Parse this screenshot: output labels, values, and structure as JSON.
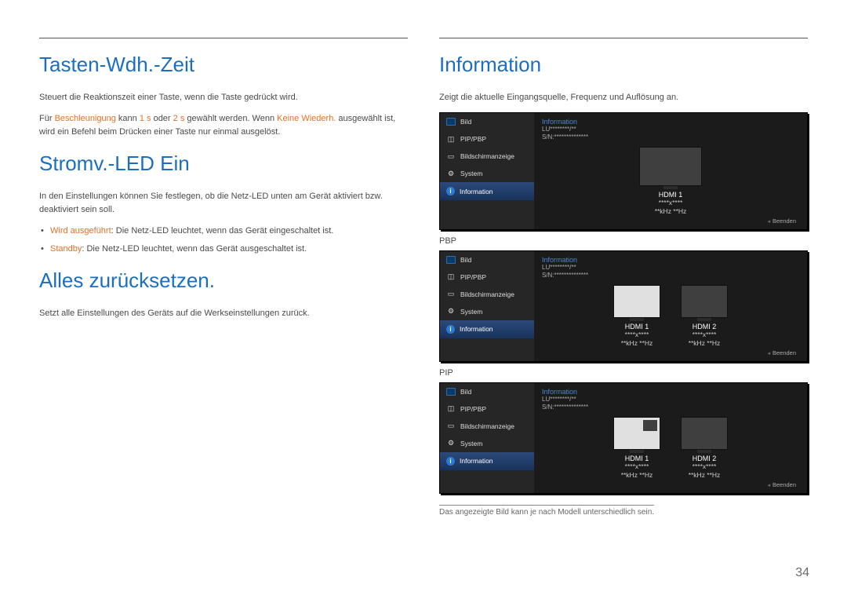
{
  "left": {
    "section1": {
      "title": "Tasten-Wdh.-Zeit",
      "p1": "Steuert die Reaktionszeit einer Taste, wenn die Taste gedrückt wird.",
      "p2_a": "Für ",
      "p2_hl1": "Beschleunigung",
      "p2_b": " kann ",
      "p2_hl2": "1 s",
      "p2_c": " oder ",
      "p2_hl3": "2 s",
      "p2_d": " gewählt werden. Wenn ",
      "p2_hl4": "Keine Wiederh.",
      "p2_e": " ausgewählt ist, wird ein Befehl beim Drücken einer Taste nur einmal ausgelöst."
    },
    "section2": {
      "title": "Stromv.-LED Ein",
      "p1": "In den Einstellungen können Sie festlegen, ob die Netz-LED unten am Gerät aktiviert bzw. deaktiviert sein soll.",
      "b1_hl": "Wird ausgeführt",
      "b1_rest": ": Die Netz-LED leuchtet, wenn das Gerät eingeschaltet ist.",
      "b2_hl": "Standby",
      "b2_rest": ": Die Netz-LED leuchtet, wenn das Gerät ausgeschaltet ist."
    },
    "section3": {
      "title": "Alles zurücksetzen.",
      "p1": "Setzt alle Einstellungen des Geräts auf die Werkseinstellungen zurück."
    }
  },
  "right": {
    "title": "Information",
    "p1": "Zeigt die aktuelle Eingangsquelle, Frequenz und Auflösung an.",
    "pbp_label": "PBP",
    "pip_label": "PIP",
    "footnote": "Das angezeigte Bild kann je nach Modell unterschiedlich sein."
  },
  "osd_menu": {
    "title": "Information",
    "model": "LU********/**",
    "serial": "S/N:**************",
    "items": {
      "bild": "Bild",
      "pippbp": "PIP/PBP",
      "bildschirm": "Bildschirmanzeige",
      "system": "System",
      "information": "Information"
    },
    "exit": "Beenden",
    "hdmi1": "HDMI 1",
    "hdmi2": "HDMI 2",
    "res": "****x****",
    "freq": "**kHz  **Hz"
  },
  "page_number": "34"
}
